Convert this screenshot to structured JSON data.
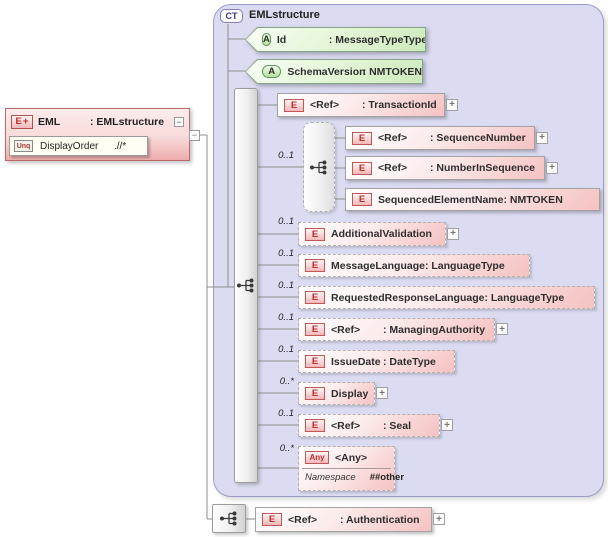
{
  "colors": {
    "element_fill": "#f5c2c2",
    "element_border": "#a3a3a3",
    "element_badge_red": "#b82e2e",
    "attribute_fill": "#cdeabc",
    "attribute_border": "#86a486",
    "container_fill": "#dbdbf2",
    "container_border": "#9b9bc9",
    "root_box_fill": "#eeacac",
    "root_box_border": "#bb6a6a",
    "constraint_fill": "#fffef2",
    "connector_line": "#8f8f8f"
  },
  "icons": {
    "expand": "+",
    "collapse": "−"
  },
  "root_element": {
    "badge": "E",
    "badge_plus": "+",
    "name": "EML",
    "type": ": EMLstructure",
    "unique": {
      "badge": "Unq",
      "name": "DisplayOrder",
      "selector": ".//*"
    }
  },
  "complex_type": {
    "badge": "CT",
    "title": "EMLstructure",
    "attributes": {
      "id": {
        "badge": "A",
        "name": "Id",
        "type": ": MessageTypeType"
      },
      "schemaVersion": {
        "badge": "A",
        "name": "SchemaVersion",
        "type": ": NMTOKEN"
      }
    }
  },
  "nodes": {
    "transactionId": {
      "badge": "E",
      "name": "<Ref>",
      "type": ": TransactionId"
    },
    "sequenceGroup": {
      "occurs": "0..1"
    },
    "sequenceNumber": {
      "badge": "E",
      "name": "<Ref>",
      "type": ": SequenceNumber"
    },
    "numberInSequence": {
      "badge": "E",
      "name": "<Ref>",
      "type": ": NumberInSequence"
    },
    "sequencedElementName": {
      "badge": "E",
      "name": "SequencedElementName",
      "type": ": NMTOKEN"
    },
    "additionalValidation": {
      "badge": "E",
      "name": "AdditionalValidation",
      "type": "",
      "occurs": "0..1"
    },
    "messageLanguage": {
      "badge": "E",
      "name": "MessageLanguage",
      "type": ": LanguageType",
      "occurs": "0..1"
    },
    "requestedResponseLanguage": {
      "badge": "E",
      "name": "RequestedResponseLanguage",
      "type": ": LanguageType",
      "occurs": "0..1"
    },
    "managingAuthority": {
      "badge": "E",
      "name": "<Ref>",
      "type": ": ManagingAuthority",
      "occurs": "0..1"
    },
    "issueDate": {
      "badge": "E",
      "name": "IssueDate",
      "type": ": DateType",
      "occurs": "0..1"
    },
    "display": {
      "badge": "E",
      "name": "Display",
      "type": "",
      "occurs": "0..*"
    },
    "seal": {
      "badge": "E",
      "name": "<Ref>",
      "type": ": Seal",
      "occurs": "0..1"
    },
    "any": {
      "badge": "Any",
      "name": "<Any>",
      "occurs": "0..*",
      "namespace_label": "Namespace",
      "namespace_value": "##other"
    },
    "authentication": {
      "badge": "E",
      "name": "<Ref>",
      "type": ": Authentication"
    }
  }
}
